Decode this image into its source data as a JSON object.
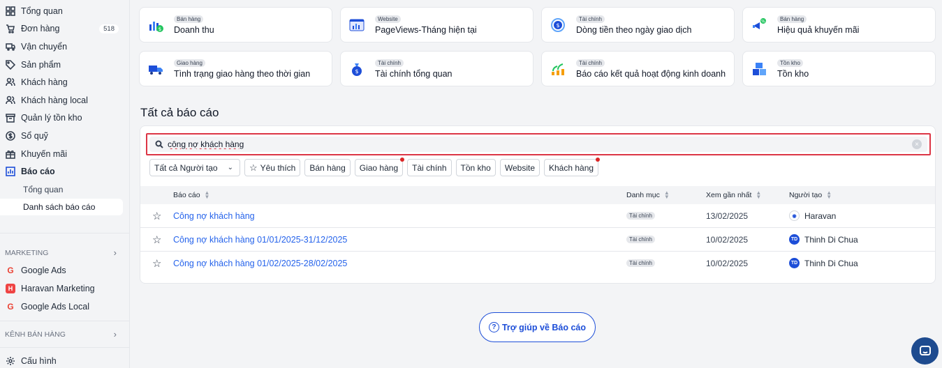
{
  "sidebar": {
    "items": [
      {
        "label": "Tổng quan",
        "icon": "dashboard-icon"
      },
      {
        "label": "Đơn hàng",
        "icon": "cart-icon",
        "badge": "518"
      },
      {
        "label": "Vận chuyển",
        "icon": "truck-icon"
      },
      {
        "label": "Sản phẩm",
        "icon": "tag-icon"
      },
      {
        "label": "Khách hàng",
        "icon": "users-icon"
      },
      {
        "label": "Khách hàng local",
        "icon": "users-icon"
      },
      {
        "label": "Quản lý tồn kho",
        "icon": "inventory-icon"
      },
      {
        "label": "Sổ quỹ",
        "icon": "dollar-icon"
      },
      {
        "label": "Khuyến mãi",
        "icon": "gift-icon"
      },
      {
        "label": "Báo cáo",
        "icon": "chart-icon"
      }
    ],
    "report_subitems": [
      {
        "label": "Tổng quan"
      },
      {
        "label": "Danh sách báo cáo"
      }
    ],
    "marketing_label": "MARKETING",
    "marketing_items": [
      {
        "label": "Google Ads",
        "icon": "google-icon"
      },
      {
        "label": "Haravan Marketing",
        "icon": "haravan-marketing-icon"
      },
      {
        "label": "Google Ads Local",
        "icon": "google-icon"
      }
    ],
    "channels_label": "KÊNH BÁN HÀNG",
    "settings_label": "Cấu hình"
  },
  "featured_cards": [
    {
      "tag": "Bán hàng",
      "title": "Doanh thu",
      "icon": "revenue-chart-icon"
    },
    {
      "tag": "Website",
      "title": "PageViews-Tháng hiện tại",
      "icon": "pageviews-icon"
    },
    {
      "tag": "Tài chính",
      "title": "Dòng tiền theo ngày giao dịch",
      "icon": "cashflow-icon"
    },
    {
      "tag": "Bán hàng",
      "title": "Hiệu quả khuyến mãi",
      "icon": "promotion-icon"
    },
    {
      "tag": "Giao hàng",
      "title": "Tình trạng giao hàng theo thời gian",
      "icon": "delivery-truck-icon"
    },
    {
      "tag": "Tài chính",
      "title": "Tài chính tổng quan",
      "icon": "money-bag-icon"
    },
    {
      "tag": "Tài chính",
      "title": "Báo cáo kết quả hoạt động kinh doanh",
      "icon": "growth-plant-icon"
    },
    {
      "tag": "Tồn kho",
      "title": "Tồn kho",
      "icon": "stock-boxes-icon"
    }
  ],
  "all_reports_title": "Tất cả báo cáo",
  "search": {
    "value": "công nợ khách hàng"
  },
  "filters": {
    "creator_select": "Tất cả Người tạo",
    "chips": [
      {
        "label": "Yêu thích",
        "star": true
      },
      {
        "label": "Bán hàng"
      },
      {
        "label": "Giao hàng",
        "dot": true
      },
      {
        "label": "Tài chính"
      },
      {
        "label": "Tồn kho"
      },
      {
        "label": "Website"
      },
      {
        "label": "Khách hàng",
        "dot": true
      }
    ]
  },
  "table": {
    "headers": {
      "report": "Báo cáo",
      "category": "Danh mục",
      "last_viewed": "Xem gần nhất",
      "creator": "Người tạo"
    },
    "rows": [
      {
        "name": "Công nợ khách hàng",
        "category": "Tài chính",
        "date": "13/02/2025",
        "creator": "Haravan",
        "avatar": ""
      },
      {
        "name": "Công nợ khách hàng 01/01/2025-31/12/2025",
        "category": "Tài chính",
        "date": "10/02/2025",
        "creator": "Thinh Di Chua",
        "avatar": "TD"
      },
      {
        "name": "Công nợ khách hàng 01/02/2025-28/02/2025",
        "category": "Tài chính",
        "date": "10/02/2025",
        "creator": "Thinh Di Chua",
        "avatar": "TD"
      }
    ]
  },
  "help_button": "Trợ giúp về Báo cáo",
  "colors": {
    "accent": "#1d4ed8",
    "link": "#2563eb",
    "highlight": "#dc3545"
  }
}
